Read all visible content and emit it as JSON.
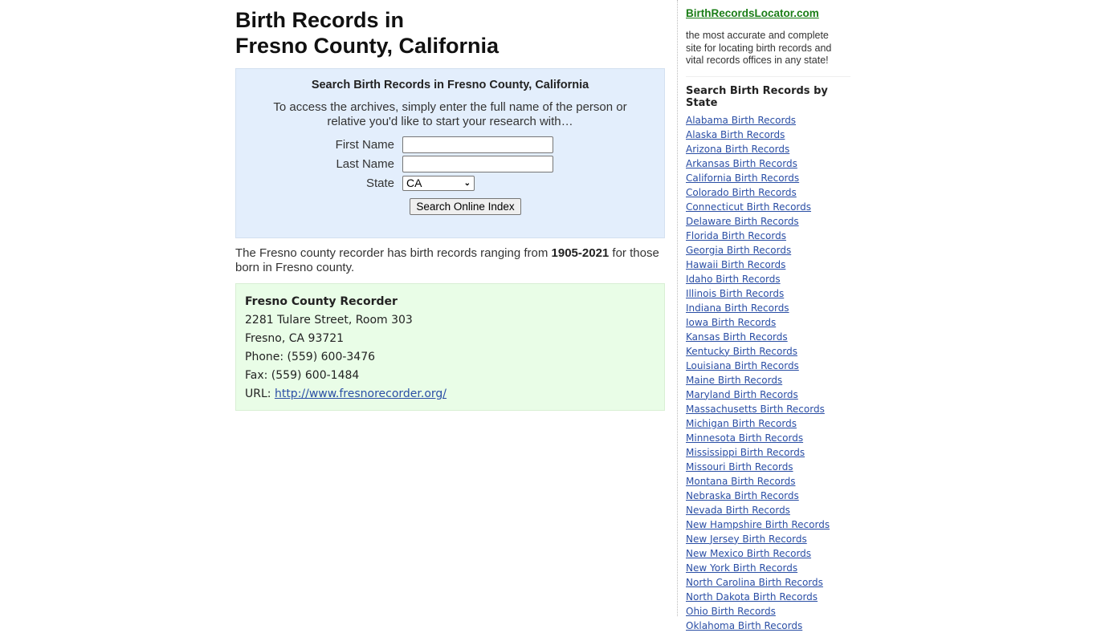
{
  "page": {
    "title_line1": "Birth Records in",
    "title_line2": "Fresno County, California"
  },
  "search": {
    "heading": "Search Birth Records in Fresno County, California",
    "intro": "To access the archives, simply enter the full name of the person or relative you'd like to start your research with…",
    "first_name_label": "First Name",
    "first_name_value": "",
    "last_name_label": "Last Name",
    "last_name_value": "",
    "state_label": "State",
    "state_value": "CA",
    "submit_label": "Search Online Index"
  },
  "description": {
    "before": "The Fresno county recorder has birth records ranging from ",
    "range": "1905-2021",
    "after": " for those born in Fresno county."
  },
  "office": {
    "name": "Fresno County Recorder",
    "address1": "2281 Tulare Street, Room 303",
    "address2": "Fresno, CA 93721",
    "phone": "Phone: (559) 600-3476",
    "fax": "Fax: (559) 600-1484",
    "url_label": "URL: ",
    "url": "http://www.fresnorecorder.org/"
  },
  "sidebar": {
    "brand": "BirthRecordsLocator.com",
    "tagline": "the most accurate and complete site for locating birth records and vital records offices in any state!",
    "heading": "Search Birth Records by State",
    "states": [
      "Alabama Birth Records",
      "Alaska Birth Records",
      "Arizona Birth Records",
      "Arkansas Birth Records",
      "California Birth Records",
      "Colorado Birth Records",
      "Connecticut Birth Records",
      "Delaware Birth Records",
      "Florida Birth Records",
      "Georgia Birth Records",
      "Hawaii Birth Records",
      "Idaho Birth Records",
      "Illinois Birth Records",
      "Indiana Birth Records",
      "Iowa Birth Records",
      "Kansas Birth Records",
      "Kentucky Birth Records",
      "Louisiana Birth Records",
      "Maine Birth Records",
      "Maryland Birth Records",
      "Massachusetts Birth Records",
      "Michigan Birth Records",
      "Minnesota Birth Records",
      "Mississippi Birth Records",
      "Missouri Birth Records",
      "Montana Birth Records",
      "Nebraska Birth Records",
      "Nevada Birth Records",
      "New Hampshire Birth Records",
      "New Jersey Birth Records",
      "New Mexico Birth Records",
      "New York Birth Records",
      "North Carolina Birth Records",
      "North Dakota Birth Records",
      "Ohio Birth Records",
      "Oklahoma Birth Records"
    ]
  },
  "colors": {
    "search_bg": "#e3eefc",
    "office_bg": "#e9fde7",
    "link": "#2a4ea5",
    "brand": "#1a7d16"
  }
}
